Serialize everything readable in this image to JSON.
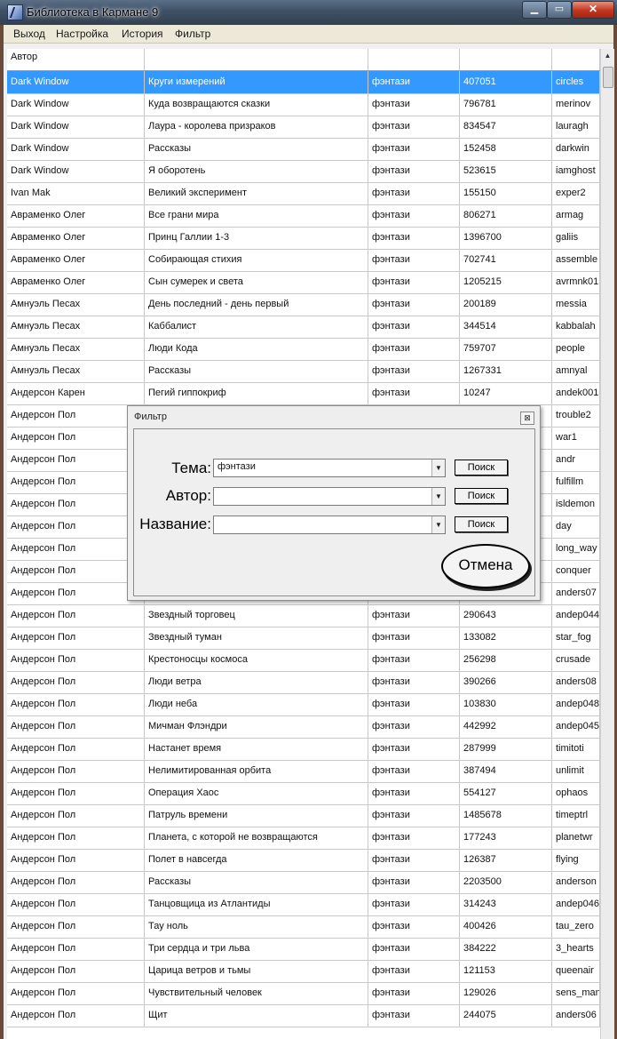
{
  "window": {
    "title": "Библиотека в Кармане 9",
    "min_label": "▁",
    "max_label": "▭",
    "close_label": "✕"
  },
  "menu": [
    "Выход",
    "Настройка",
    "История",
    "Фильтр"
  ],
  "grid": {
    "header": [
      "Автор",
      "",
      "",
      "",
      ""
    ],
    "selected_index": 0,
    "rows": [
      [
        "Dark Window",
        "Круги измерений",
        "фэнтази",
        "407051",
        "circles"
      ],
      [
        "Dark Window",
        "Куда возвращаются сказки",
        "фэнтази",
        "796781",
        "merinov"
      ],
      [
        "Dark Window",
        "Лаура - королева призраков",
        "фэнтази",
        "834547",
        "lauragh"
      ],
      [
        "Dark Window",
        "Рассказы",
        "фэнтази",
        "152458",
        "darkwin"
      ],
      [
        "Dark Window",
        "Я оборотень",
        "фэнтази",
        "523615",
        "iamghost"
      ],
      [
        "Ivan Mak",
        "Великий эксперимент",
        "фэнтази",
        "155150",
        "exper2"
      ],
      [
        "Авраменко Олег",
        "Все грани мира",
        "фэнтази",
        "806271",
        "armag"
      ],
      [
        "Авраменко Олег",
        "Принц Галлии 1-3",
        "фэнтази",
        "1396700",
        "galiis"
      ],
      [
        "Авраменко Олег",
        "Собирающая стихия",
        "фэнтази",
        "702741",
        "assemble"
      ],
      [
        "Авраменко Олег",
        "Сын сумерек и света",
        "фэнтази",
        "1205215",
        "avrmnk01"
      ],
      [
        "Амнуэль Песах",
        "День последний - день первый",
        "фэнтази",
        "200189",
        "messia"
      ],
      [
        "Амнуэль Песах",
        "Каббалист",
        "фэнтази",
        "344514",
        "kabbalah"
      ],
      [
        "Амнуэль Песах",
        "Люди Кода",
        "фэнтази",
        "759707",
        "people"
      ],
      [
        "Амнуэль Песах",
        "Рассказы",
        "фэнтази",
        "1267331",
        "amnyal"
      ],
      [
        "Андерсон Карен",
        "Пегий гиппокриф",
        "фэнтази",
        "10247",
        "andek001"
      ],
      [
        "Андерсон Пол",
        "",
        "",
        "",
        "trouble2"
      ],
      [
        "Андерсон Пол",
        "",
        "",
        "",
        "war1"
      ],
      [
        "Андерсон Пол",
        "",
        "",
        "",
        "andr"
      ],
      [
        "Андерсон Пол",
        "",
        "",
        "",
        "fulfillm"
      ],
      [
        "Андерсон Пол",
        "",
        "",
        "",
        "isldemon"
      ],
      [
        "Андерсон Пол",
        "",
        "",
        "",
        "day"
      ],
      [
        "Андерсон Пол",
        "",
        "",
        "",
        "long_way"
      ],
      [
        "Андерсон Пол",
        "",
        "",
        "",
        "conquer"
      ],
      [
        "Андерсон Пол",
        "",
        "",
        "",
        "anders07"
      ],
      [
        "Андерсон Пол",
        "Звездный торговец",
        "фэнтази",
        "290643",
        "andep044"
      ],
      [
        "Андерсон Пол",
        "Звездный туман",
        "фэнтази",
        "133082",
        "star_fog"
      ],
      [
        "Андерсон Пол",
        "Крестоносцы космоса",
        "фэнтази",
        "256298",
        "crusade"
      ],
      [
        "Андерсон Пол",
        "Люди ветра",
        "фэнтази",
        "390266",
        "anders08"
      ],
      [
        "Андерсон Пол",
        "Люди неба",
        "фэнтази",
        "103830",
        "andep048"
      ],
      [
        "Андерсон Пол",
        "Мичман Флэндри",
        "фэнтази",
        "442992",
        "andep045"
      ],
      [
        "Андерсон Пол",
        "Настанет время",
        "фэнтази",
        "287999",
        "timitoti"
      ],
      [
        "Андерсон Пол",
        "Нелимитированная орбита",
        "фэнтази",
        "387494",
        "unlimit"
      ],
      [
        "Андерсон Пол",
        "Операция Хаос",
        "фэнтази",
        "554127",
        "ophaos"
      ],
      [
        "Андерсон Пол",
        "Патруль времени",
        "фэнтази",
        "1485678",
        "timeptrl"
      ],
      [
        "Андерсон Пол",
        "Планета, с которой не возвращаются",
        "фэнтази",
        "177243",
        "planetwr"
      ],
      [
        "Андерсон Пол",
        "Полет в навсегда",
        "фэнтази",
        "126387",
        "flying"
      ],
      [
        "Андерсон Пол",
        "Рассказы",
        "фэнтази",
        "2203500",
        "anderson"
      ],
      [
        "Андерсон Пол",
        "Танцовщица из Атлантиды",
        "фэнтази",
        "314243",
        "andep046"
      ],
      [
        "Андерсон Пол",
        "Тау ноль",
        "фэнтази",
        "400426",
        "tau_zero"
      ],
      [
        "Андерсон Пол",
        "Три сердца и три льва",
        "фэнтази",
        "384222",
        "3_hearts"
      ],
      [
        "Андерсон Пол",
        "Царица ветров и тьмы",
        "фэнтази",
        "121153",
        "queenair"
      ],
      [
        "Андерсон Пол",
        "Чувствительный человек",
        "фэнтази",
        "129026",
        "sens_man"
      ],
      [
        "Андерсон Пол",
        "Щит",
        "фэнтази",
        "244075",
        "anders06"
      ]
    ]
  },
  "dialog": {
    "title": "Фильтр",
    "close_glyph": "⊠",
    "fields": [
      {
        "label": "Тема:",
        "value": "фэнтази",
        "button": "Поиск"
      },
      {
        "label": "Автор:",
        "value": "",
        "button": "Поиск"
      },
      {
        "label": "Название:",
        "value": "",
        "button": "Поиск"
      }
    ],
    "cancel_label": "Отмена"
  }
}
